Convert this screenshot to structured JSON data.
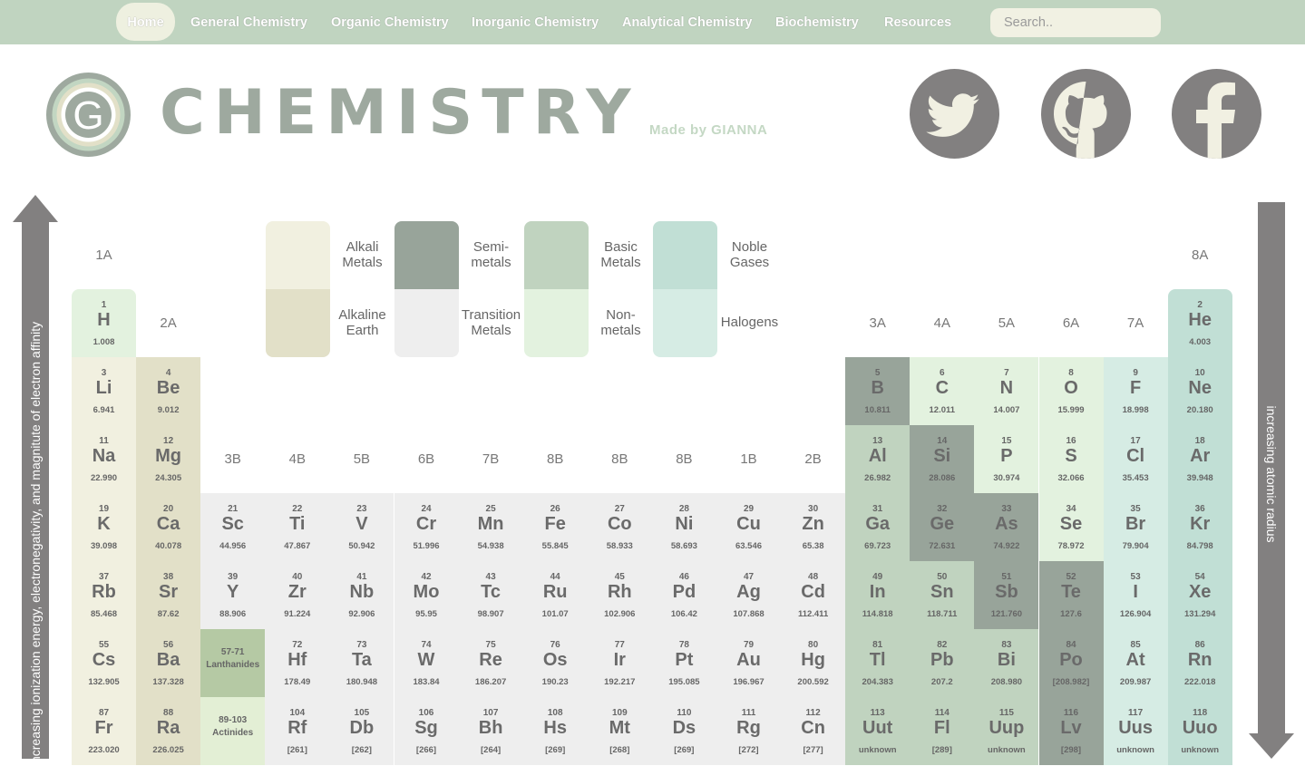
{
  "nav": {
    "items": [
      {
        "label": "Home",
        "active": true
      },
      {
        "label": "General Chemistry"
      },
      {
        "label": "Organic Chemistry"
      },
      {
        "label": "Inorganic Chemistry"
      },
      {
        "label": "Analytical Chemistry"
      },
      {
        "label": "Biochemistry"
      },
      {
        "label": "Resources"
      }
    ],
    "search_placeholder": "Search.."
  },
  "header": {
    "logo_letter": "G",
    "title": "CHEMISTRY",
    "byline": "Made by GIANNA",
    "social": [
      {
        "name": "twitter",
        "icon": "twitter-icon"
      },
      {
        "name": "github",
        "icon": "github-icon"
      },
      {
        "name": "facebook",
        "icon": "facebook-icon"
      }
    ]
  },
  "trends": {
    "left_arrow": "increasing ionization energy, electronegativity, and magnitute of electron affinity",
    "right_arrow": "increasing atomic radius"
  },
  "colors": {
    "nav_bg": "#c0d4c0",
    "alkali": "#f1f0e0",
    "alkaline_earth": "#e2e0c8",
    "semi": "#98a49a",
    "transition": "#eeeeee",
    "basic": "#c0d3bf",
    "nonmetal": "#e3f2df",
    "halogen": "#d6ece4",
    "noble": "#c1dfd5",
    "arrow": "#828080"
  },
  "legend": [
    {
      "label": "Alkali Metals",
      "cat": "alk"
    },
    {
      "label": "Alkaline Earth",
      "cat": "alke"
    },
    {
      "label": "Semi-metals",
      "cat": "semi"
    },
    {
      "label": "Transition Metals",
      "cat": "trans"
    },
    {
      "label": "Basic Metals",
      "cat": "basic"
    },
    {
      "label": "Non-metals",
      "cat": "nonm"
    },
    {
      "label": "Noble Gases",
      "cat": "noble"
    },
    {
      "label": "Halogens",
      "cat": "halo"
    }
  ],
  "groups": [
    "1A",
    "2A",
    "3B",
    "4B",
    "5B",
    "6B",
    "7B",
    "8B",
    "8B",
    "8B",
    "1B",
    "2B",
    "3A",
    "4A",
    "5A",
    "6A",
    "7A",
    "8A"
  ],
  "elements": [
    {
      "n": "1",
      "s": "H",
      "m": "1.008",
      "cat": "nonm",
      "col": 1,
      "row": 1
    },
    {
      "n": "2",
      "s": "He",
      "m": "4.003",
      "cat": "noble",
      "col": 18,
      "row": 1
    },
    {
      "n": "3",
      "s": "Li",
      "m": "6.941",
      "cat": "alk",
      "col": 1,
      "row": 2
    },
    {
      "n": "4",
      "s": "Be",
      "m": "9.012",
      "cat": "alke",
      "col": 2,
      "row": 2
    },
    {
      "n": "5",
      "s": "B",
      "m": "10.811",
      "cat": "semi",
      "col": 13,
      "row": 2
    },
    {
      "n": "6",
      "s": "C",
      "m": "12.011",
      "cat": "nonm",
      "col": 14,
      "row": 2
    },
    {
      "n": "7",
      "s": "N",
      "m": "14.007",
      "cat": "nonm",
      "col": 15,
      "row": 2
    },
    {
      "n": "8",
      "s": "O",
      "m": "15.999",
      "cat": "nonm",
      "col": 16,
      "row": 2
    },
    {
      "n": "9",
      "s": "F",
      "m": "18.998",
      "cat": "halo",
      "col": 17,
      "row": 2
    },
    {
      "n": "10",
      "s": "Ne",
      "m": "20.180",
      "cat": "noble",
      "col": 18,
      "row": 2
    },
    {
      "n": "11",
      "s": "Na",
      "m": "22.990",
      "cat": "alk",
      "col": 1,
      "row": 3
    },
    {
      "n": "12",
      "s": "Mg",
      "m": "24.305",
      "cat": "alke",
      "col": 2,
      "row": 3
    },
    {
      "n": "13",
      "s": "Al",
      "m": "26.982",
      "cat": "basic",
      "col": 13,
      "row": 3
    },
    {
      "n": "14",
      "s": "Si",
      "m": "28.086",
      "cat": "semi",
      "col": 14,
      "row": 3
    },
    {
      "n": "15",
      "s": "P",
      "m": "30.974",
      "cat": "nonm",
      "col": 15,
      "row": 3
    },
    {
      "n": "16",
      "s": "S",
      "m": "32.066",
      "cat": "nonm",
      "col": 16,
      "row": 3
    },
    {
      "n": "17",
      "s": "Cl",
      "m": "35.453",
      "cat": "halo",
      "col": 17,
      "row": 3
    },
    {
      "n": "18",
      "s": "Ar",
      "m": "39.948",
      "cat": "noble",
      "col": 18,
      "row": 3
    },
    {
      "n": "19",
      "s": "K",
      "m": "39.098",
      "cat": "alk",
      "col": 1,
      "row": 4
    },
    {
      "n": "20",
      "s": "Ca",
      "m": "40.078",
      "cat": "alke",
      "col": 2,
      "row": 4
    },
    {
      "n": "21",
      "s": "Sc",
      "m": "44.956",
      "cat": "trans",
      "col": 3,
      "row": 4
    },
    {
      "n": "22",
      "s": "Ti",
      "m": "47.867",
      "cat": "trans",
      "col": 4,
      "row": 4
    },
    {
      "n": "23",
      "s": "V",
      "m": "50.942",
      "cat": "trans",
      "col": 5,
      "row": 4
    },
    {
      "n": "24",
      "s": "Cr",
      "m": "51.996",
      "cat": "trans",
      "col": 6,
      "row": 4
    },
    {
      "n": "25",
      "s": "Mn",
      "m": "54.938",
      "cat": "trans",
      "col": 7,
      "row": 4
    },
    {
      "n": "26",
      "s": "Fe",
      "m": "55.845",
      "cat": "trans",
      "col": 8,
      "row": 4
    },
    {
      "n": "27",
      "s": "Co",
      "m": "58.933",
      "cat": "trans",
      "col": 9,
      "row": 4
    },
    {
      "n": "28",
      "s": "Ni",
      "m": "58.693",
      "cat": "trans",
      "col": 10,
      "row": 4
    },
    {
      "n": "29",
      "s": "Cu",
      "m": "63.546",
      "cat": "trans",
      "col": 11,
      "row": 4
    },
    {
      "n": "30",
      "s": "Zn",
      "m": "65.38",
      "cat": "trans",
      "col": 12,
      "row": 4
    },
    {
      "n": "31",
      "s": "Ga",
      "m": "69.723",
      "cat": "basic",
      "col": 13,
      "row": 4
    },
    {
      "n": "32",
      "s": "Ge",
      "m": "72.631",
      "cat": "semi",
      "col": 14,
      "row": 4
    },
    {
      "n": "33",
      "s": "As",
      "m": "74.922",
      "cat": "semi",
      "col": 15,
      "row": 4
    },
    {
      "n": "34",
      "s": "Se",
      "m": "78.972",
      "cat": "nonm",
      "col": 16,
      "row": 4
    },
    {
      "n": "35",
      "s": "Br",
      "m": "79.904",
      "cat": "halo",
      "col": 17,
      "row": 4
    },
    {
      "n": "36",
      "s": "Kr",
      "m": "84.798",
      "cat": "noble",
      "col": 18,
      "row": 4
    },
    {
      "n": "37",
      "s": "Rb",
      "m": "85.468",
      "cat": "alk",
      "col": 1,
      "row": 5
    },
    {
      "n": "38",
      "s": "Sr",
      "m": "87.62",
      "cat": "alke",
      "col": 2,
      "row": 5
    },
    {
      "n": "39",
      "s": "Y",
      "m": "88.906",
      "cat": "trans",
      "col": 3,
      "row": 5
    },
    {
      "n": "40",
      "s": "Zr",
      "m": "91.224",
      "cat": "trans",
      "col": 4,
      "row": 5
    },
    {
      "n": "41",
      "s": "Nb",
      "m": "92.906",
      "cat": "trans",
      "col": 5,
      "row": 5
    },
    {
      "n": "42",
      "s": "Mo",
      "m": "95.95",
      "cat": "trans",
      "col": 6,
      "row": 5
    },
    {
      "n": "43",
      "s": "Tc",
      "m": "98.907",
      "cat": "trans",
      "col": 7,
      "row": 5
    },
    {
      "n": "44",
      "s": "Ru",
      "m": "101.07",
      "cat": "trans",
      "col": 8,
      "row": 5
    },
    {
      "n": "45",
      "s": "Rh",
      "m": "102.906",
      "cat": "trans",
      "col": 9,
      "row": 5
    },
    {
      "n": "46",
      "s": "Pd",
      "m": "106.42",
      "cat": "trans",
      "col": 10,
      "row": 5
    },
    {
      "n": "47",
      "s": "Ag",
      "m": "107.868",
      "cat": "trans",
      "col": 11,
      "row": 5
    },
    {
      "n": "48",
      "s": "Cd",
      "m": "112.411",
      "cat": "trans",
      "col": 12,
      "row": 5
    },
    {
      "n": "49",
      "s": "In",
      "m": "114.818",
      "cat": "basic",
      "col": 13,
      "row": 5
    },
    {
      "n": "50",
      "s": "Sn",
      "m": "118.711",
      "cat": "basic",
      "col": 14,
      "row": 5
    },
    {
      "n": "51",
      "s": "Sb",
      "m": "121.760",
      "cat": "semi",
      "col": 15,
      "row": 5
    },
    {
      "n": "52",
      "s": "Te",
      "m": "127.6",
      "cat": "semi",
      "col": 16,
      "row": 5
    },
    {
      "n": "53",
      "s": "I",
      "m": "126.904",
      "cat": "halo",
      "col": 17,
      "row": 5
    },
    {
      "n": "54",
      "s": "Xe",
      "m": "131.294",
      "cat": "noble",
      "col": 18,
      "row": 5
    },
    {
      "n": "55",
      "s": "Cs",
      "m": "132.905",
      "cat": "alk",
      "col": 1,
      "row": 6
    },
    {
      "n": "56",
      "s": "Ba",
      "m": "137.328",
      "cat": "alke",
      "col": 2,
      "row": 6
    },
    {
      "ref": "57-71",
      "label": "Lanthanides",
      "cat": "lan",
      "col": 3,
      "row": 6
    },
    {
      "n": "72",
      "s": "Hf",
      "m": "178.49",
      "cat": "trans",
      "col": 4,
      "row": 6
    },
    {
      "n": "73",
      "s": "Ta",
      "m": "180.948",
      "cat": "trans",
      "col": 5,
      "row": 6
    },
    {
      "n": "74",
      "s": "W",
      "m": "183.84",
      "cat": "trans",
      "col": 6,
      "row": 6
    },
    {
      "n": "75",
      "s": "Re",
      "m": "186.207",
      "cat": "trans",
      "col": 7,
      "row": 6
    },
    {
      "n": "76",
      "s": "Os",
      "m": "190.23",
      "cat": "trans",
      "col": 8,
      "row": 6
    },
    {
      "n": "77",
      "s": "Ir",
      "m": "192.217",
      "cat": "trans",
      "col": 9,
      "row": 6
    },
    {
      "n": "78",
      "s": "Pt",
      "m": "195.085",
      "cat": "trans",
      "col": 10,
      "row": 6
    },
    {
      "n": "79",
      "s": "Au",
      "m": "196.967",
      "cat": "trans",
      "col": 11,
      "row": 6
    },
    {
      "n": "80",
      "s": "Hg",
      "m": "200.592",
      "cat": "trans",
      "col": 12,
      "row": 6
    },
    {
      "n": "81",
      "s": "Tl",
      "m": "204.383",
      "cat": "basic",
      "col": 13,
      "row": 6
    },
    {
      "n": "82",
      "s": "Pb",
      "m": "207.2",
      "cat": "basic",
      "col": 14,
      "row": 6
    },
    {
      "n": "83",
      "s": "Bi",
      "m": "208.980",
      "cat": "basic",
      "col": 15,
      "row": 6
    },
    {
      "n": "84",
      "s": "Po",
      "m": "[208.982]",
      "cat": "semi",
      "col": 16,
      "row": 6
    },
    {
      "n": "85",
      "s": "At",
      "m": "209.987",
      "cat": "halo",
      "col": 17,
      "row": 6
    },
    {
      "n": "86",
      "s": "Rn",
      "m": "222.018",
      "cat": "noble",
      "col": 18,
      "row": 6
    },
    {
      "n": "87",
      "s": "Fr",
      "m": "223.020",
      "cat": "alk",
      "col": 1,
      "row": 7
    },
    {
      "n": "88",
      "s": "Ra",
      "m": "226.025",
      "cat": "alke",
      "col": 2,
      "row": 7
    },
    {
      "ref": "89-103",
      "label": "Actinides",
      "cat": "act",
      "col": 3,
      "row": 7
    },
    {
      "n": "104",
      "s": "Rf",
      "m": "[261]",
      "cat": "trans",
      "col": 4,
      "row": 7
    },
    {
      "n": "105",
      "s": "Db",
      "m": "[262]",
      "cat": "trans",
      "col": 5,
      "row": 7
    },
    {
      "n": "106",
      "s": "Sg",
      "m": "[266]",
      "cat": "trans",
      "col": 6,
      "row": 7
    },
    {
      "n": "107",
      "s": "Bh",
      "m": "[264]",
      "cat": "trans",
      "col": 7,
      "row": 7
    },
    {
      "n": "108",
      "s": "Hs",
      "m": "[269]",
      "cat": "trans",
      "col": 8,
      "row": 7
    },
    {
      "n": "109",
      "s": "Mt",
      "m": "[268]",
      "cat": "trans",
      "col": 9,
      "row": 7
    },
    {
      "n": "110",
      "s": "Ds",
      "m": "[269]",
      "cat": "trans",
      "col": 10,
      "row": 7
    },
    {
      "n": "111",
      "s": "Rg",
      "m": "[272]",
      "cat": "trans",
      "col": 11,
      "row": 7
    },
    {
      "n": "112",
      "s": "Cn",
      "m": "[277]",
      "cat": "trans",
      "col": 12,
      "row": 7
    },
    {
      "n": "113",
      "s": "Uut",
      "m": "unknown",
      "cat": "basic",
      "col": 13,
      "row": 7
    },
    {
      "n": "114",
      "s": "Fl",
      "m": "[289]",
      "cat": "basic",
      "col": 14,
      "row": 7
    },
    {
      "n": "115",
      "s": "Uup",
      "m": "unknown",
      "cat": "basic",
      "col": 15,
      "row": 7
    },
    {
      "n": "116",
      "s": "Lv",
      "m": "[298]",
      "cat": "semi",
      "col": 16,
      "row": 7
    },
    {
      "n": "117",
      "s": "Uus",
      "m": "unknown",
      "cat": "halo",
      "col": 17,
      "row": 7
    },
    {
      "n": "118",
      "s": "Uuo",
      "m": "unknown",
      "cat": "noble",
      "col": 18,
      "row": 7
    }
  ]
}
